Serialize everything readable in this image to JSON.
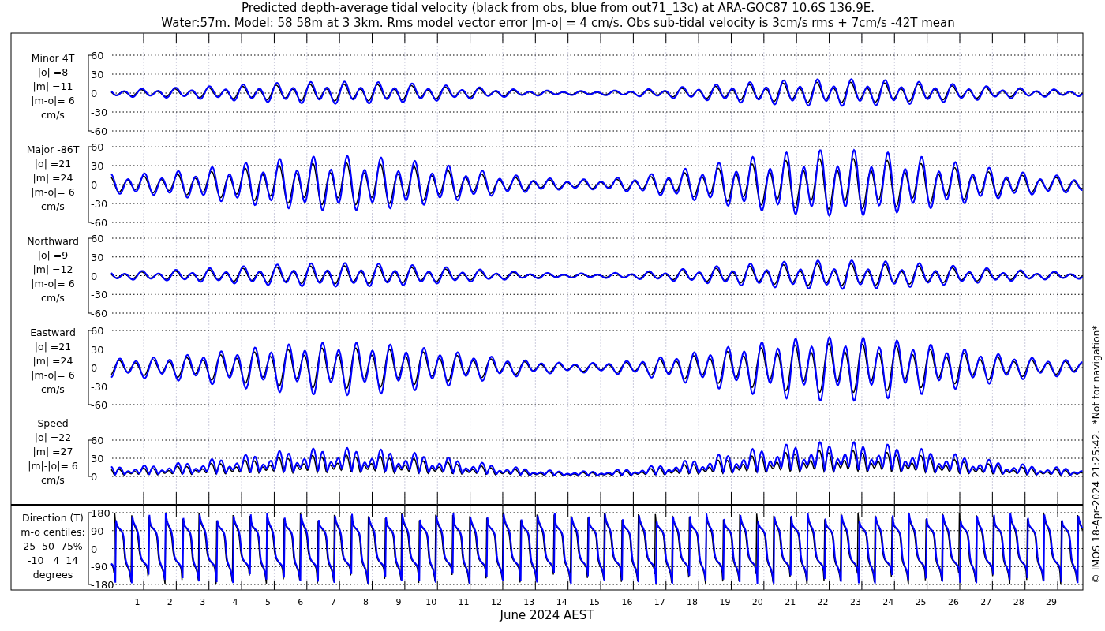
{
  "title_lines": [
    "Predicted depth-average tidal velocity (black from obs, blue from out71_13c) at ARA-GOC87 10.6S 136.9E.",
    "Water:57m. Model: 58 58m at 3 3km. Rms model vector error |m-o| = 4 cm/s. Obs sub-tidal velocity is 3cm/s rms + 7cm/s -42T mean"
  ],
  "panels": [
    {
      "kind": "minor",
      "label_lines": [
        "Minor 4T",
        "|o| =8",
        "|m| =11",
        "|m-o|= 6",
        "cm/s"
      ],
      "ticks": [
        "60",
        "30",
        "0",
        "-30",
        "-60"
      ]
    },
    {
      "kind": "major",
      "label_lines": [
        "Major -86T",
        "|o| =21",
        "|m| =24",
        "|m-o|= 6",
        "cm/s"
      ],
      "ticks": [
        "60",
        "30",
        "0",
        "-30",
        "-60"
      ]
    },
    {
      "kind": "north",
      "label_lines": [
        "Northward",
        "|o| =9",
        "|m| =12",
        "|m-o|= 6",
        "cm/s"
      ],
      "ticks": [
        "60",
        "30",
        "0",
        "-30",
        "-60"
      ]
    },
    {
      "kind": "east",
      "label_lines": [
        "Eastward",
        "|o| =21",
        "|m| =24",
        "|m-o|= 6",
        "cm/s"
      ],
      "ticks": [
        "60",
        "30",
        "0",
        "-30",
        "-60"
      ]
    },
    {
      "kind": "speed",
      "label_lines": [
        "Speed",
        "|o| =22",
        "|m| =27",
        "|m|-|o|= 6",
        "cm/s"
      ],
      "ticks": [
        "60",
        "30",
        "0"
      ]
    },
    {
      "kind": "direction",
      "label_lines": [
        "Direction (T)",
        "m-o centiles:",
        "25  50  75%",
        "-10   4  14",
        "degrees"
      ],
      "ticks": [
        "180",
        "90",
        "0",
        "-90",
        "-180"
      ]
    }
  ],
  "x_labels": [
    "1",
    "2",
    "3",
    "4",
    "5",
    "6",
    "7",
    "8",
    "9",
    "10",
    "11",
    "12",
    "13",
    "14",
    "15",
    "16",
    "17",
    "18",
    "19",
    "20",
    "21",
    "22",
    "23",
    "24",
    "25",
    "26",
    "27",
    "28",
    "29"
  ],
  "xlabel": "June 2024 AEST",
  "footer": "© IMOS 18-Apr-2024 21:25:42.  *Not for navigation*"
}
